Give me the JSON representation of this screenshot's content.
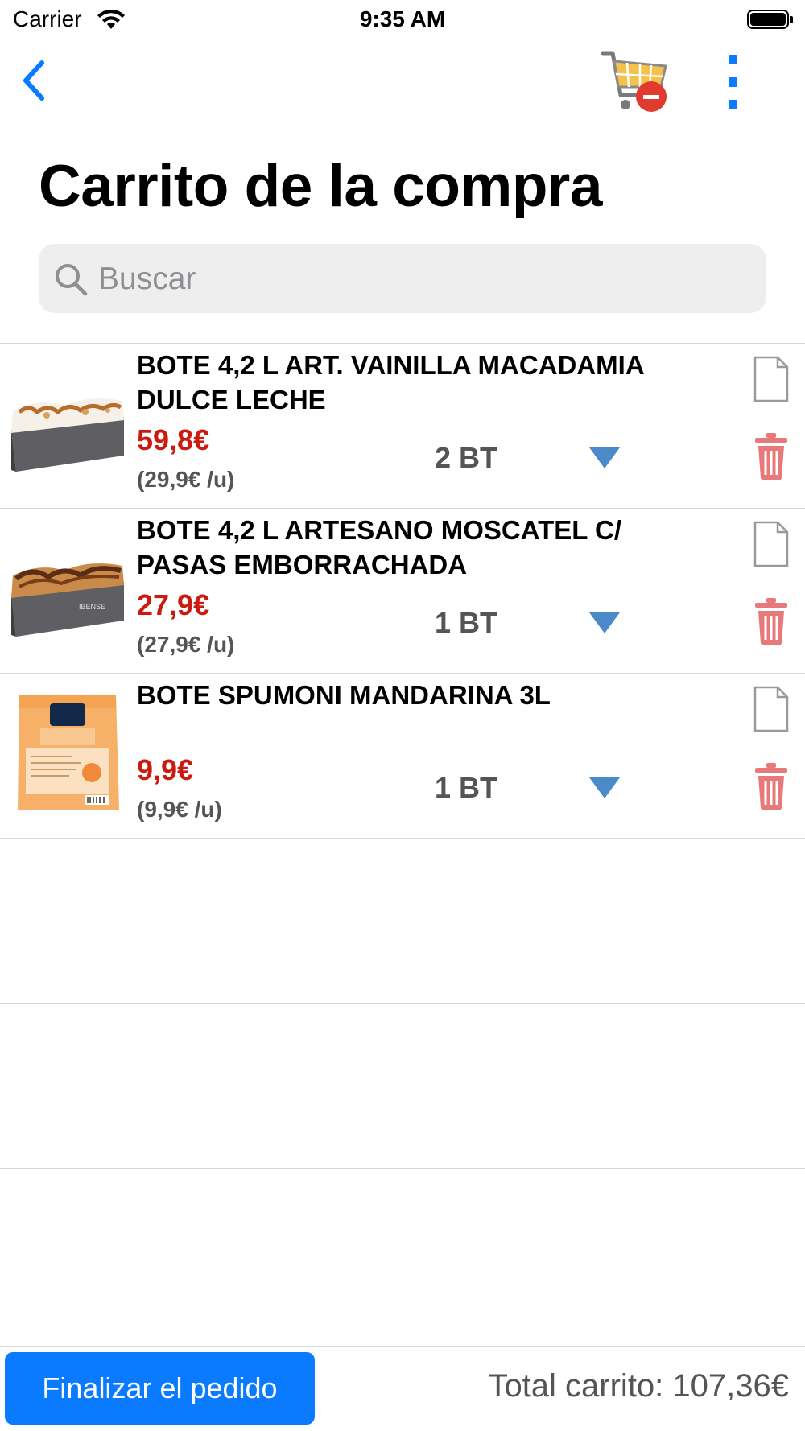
{
  "status_bar": {
    "carrier": "Carrier",
    "time": "9:35 AM"
  },
  "nav": {
    "title": "Carrito de la compra"
  },
  "search": {
    "placeholder": "Buscar",
    "value": ""
  },
  "items": [
    {
      "name": "BOTE 4,2 L ART. VAINILLA MACADAMIA DULCE LECHE",
      "price": "59,8€",
      "unit_price": "(29,9€ /u)",
      "quantity": "2 BT",
      "image": "ice-cream-tub-vanilla"
    },
    {
      "name": "BOTE 4,2 L ARTESANO MOSCATEL C/ PASAS EMBORRACHADA",
      "price": "27,9€",
      "unit_price": "(27,9€ /u)",
      "quantity": "1 BT",
      "image": "ice-cream-tub-moscatel"
    },
    {
      "name": "BOTE SPUMONI MANDARINA 3L",
      "price": "9,9€",
      "unit_price": "(9,9€ /u)",
      "quantity": "1 BT",
      "image": "spumoni-mandarina-package"
    }
  ],
  "footer": {
    "finalize_label": "Finalizar el pedido",
    "total_label": "Total carrito: 107,36€"
  },
  "colors": {
    "accent": "#0a7aff",
    "price": "#cc1a10",
    "trash": "#e8797a",
    "dropdown": "#4a8ac9"
  }
}
